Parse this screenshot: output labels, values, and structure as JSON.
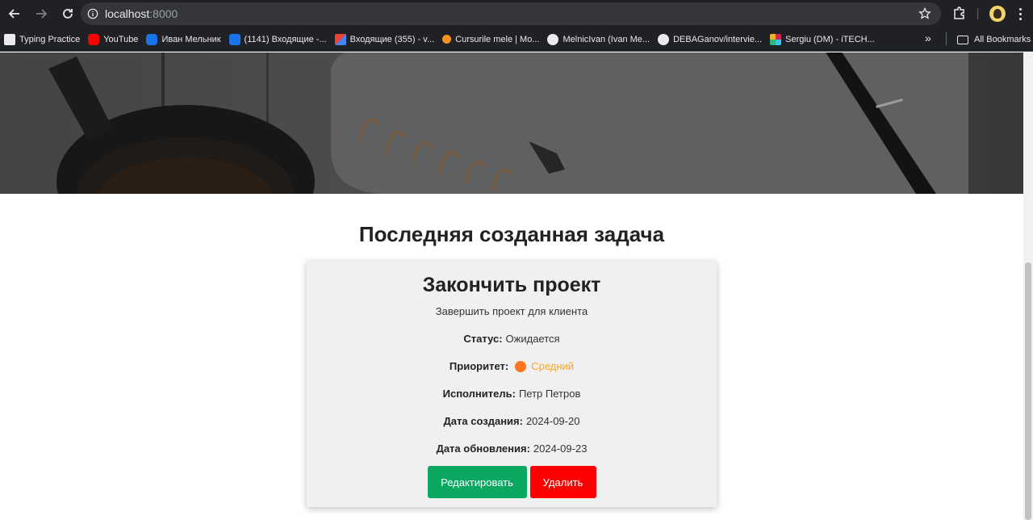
{
  "browser": {
    "url_host": "localhost",
    "url_port": ":8000",
    "bookmarks": [
      {
        "label": "Typing Practice",
        "icon": "typing-icon",
        "color": "#ffffff"
      },
      {
        "label": "YouTube",
        "icon": "youtube-icon",
        "color": "#ff0000"
      },
      {
        "label": "Иван Мельник",
        "icon": "chat-icon",
        "color": "#1a73e8"
      },
      {
        "label": "(1141) Входящие -...",
        "icon": "mail-icon",
        "color": "#1a73e8"
      },
      {
        "label": "Входящие (355) - v...",
        "icon": "gmail-icon",
        "color": "#ea4335"
      },
      {
        "label": "Cursurile mele | Mo...",
        "icon": "moodle-icon",
        "color": "#f7931e"
      },
      {
        "label": "MelnicIvan (Ivan Me...",
        "icon": "github-icon",
        "color": "#ffffff"
      },
      {
        "label": "DEBAGanov/intervie...",
        "icon": "github-icon",
        "color": "#ffffff"
      },
      {
        "label": "Sergiu (DM) - iTECH...",
        "icon": "slack-icon",
        "color": "#e01e5a"
      }
    ],
    "more": "»",
    "all_bookmarks": "All Bookmarks"
  },
  "main": {
    "section_title": "Последняя созданная задача",
    "task": {
      "title": "Закончить проект",
      "description": "Завершить проект для клиента",
      "status_label": "Статус:",
      "status_value": "Ожидается",
      "priority_label": "Приоритет:",
      "priority_value": "Средний",
      "priority_color": "#ff7522",
      "assignee_label": "Исполнитель:",
      "assignee_value": "Петр Петров",
      "created_label": "Дата создания:",
      "created_value": "2024-09-20",
      "updated_label": "Дата обновления:",
      "updated_value": "2024-09-23"
    },
    "actions": {
      "edit": "Редактировать",
      "delete": "Удалить"
    }
  }
}
